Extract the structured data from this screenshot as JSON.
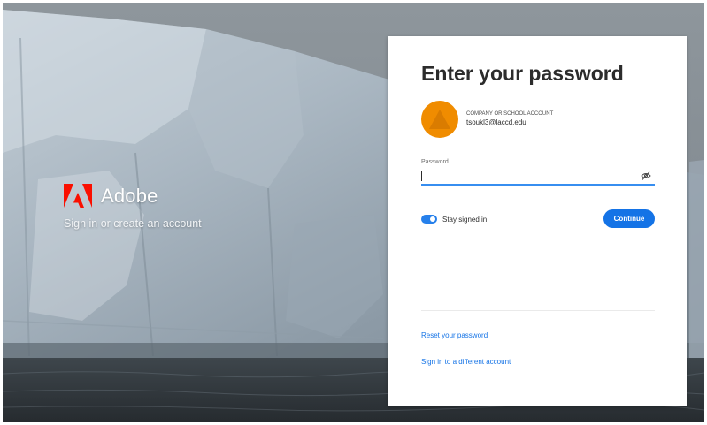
{
  "brand": {
    "name": "Adobe",
    "tagline": "Sign in or create an account",
    "logo_icon": "adobe-logo-icon",
    "logo_color": "#fa0f00"
  },
  "card": {
    "title": "Enter your password",
    "account": {
      "type_label": "COMPANY OR SCHOOL ACCOUNT",
      "email": "tsoukl3@laccd.edu",
      "avatar_color": "#f08c00"
    },
    "password": {
      "label": "Password",
      "value": "",
      "placeholder": "",
      "toggle_icon": "eye-off-icon"
    },
    "stay_signed_in": {
      "label": "Stay signed in",
      "checked": true
    },
    "continue_label": "Continue",
    "links": {
      "reset_password": "Reset your password",
      "different_account": "Sign in to a different account"
    }
  },
  "colors": {
    "accent": "#1473e6",
    "focus_underline": "#378ef0"
  }
}
